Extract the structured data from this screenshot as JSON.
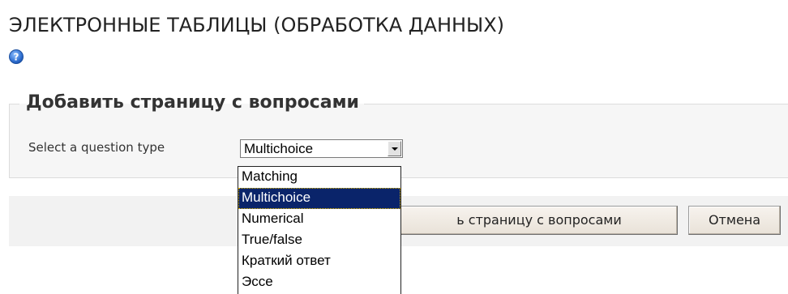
{
  "page": {
    "title": "ЭЛЕКТРОННЫЕ ТАБЛИЦЫ (ОБРАБОТКА ДАННЫХ)",
    "help_icon": "help-question-icon"
  },
  "form": {
    "legend": "Добавить страницу с вопросами",
    "question_type_label": "Select a question type",
    "question_type_selected": "Multichoice"
  },
  "dropdown": {
    "options": [
      "Matching",
      "Multichoice",
      "Numerical",
      "True/false",
      "Краткий ответ",
      "Эссе"
    ],
    "selected_index": 1
  },
  "buttons": {
    "add_page_visible_label": "ь страницу с вопросами",
    "cancel_label": "Отмена"
  },
  "colors": {
    "selected_option_bg": "#0a246a",
    "selected_option_text": "#ffffff",
    "help_icon_blue": "#2f6fd0"
  }
}
